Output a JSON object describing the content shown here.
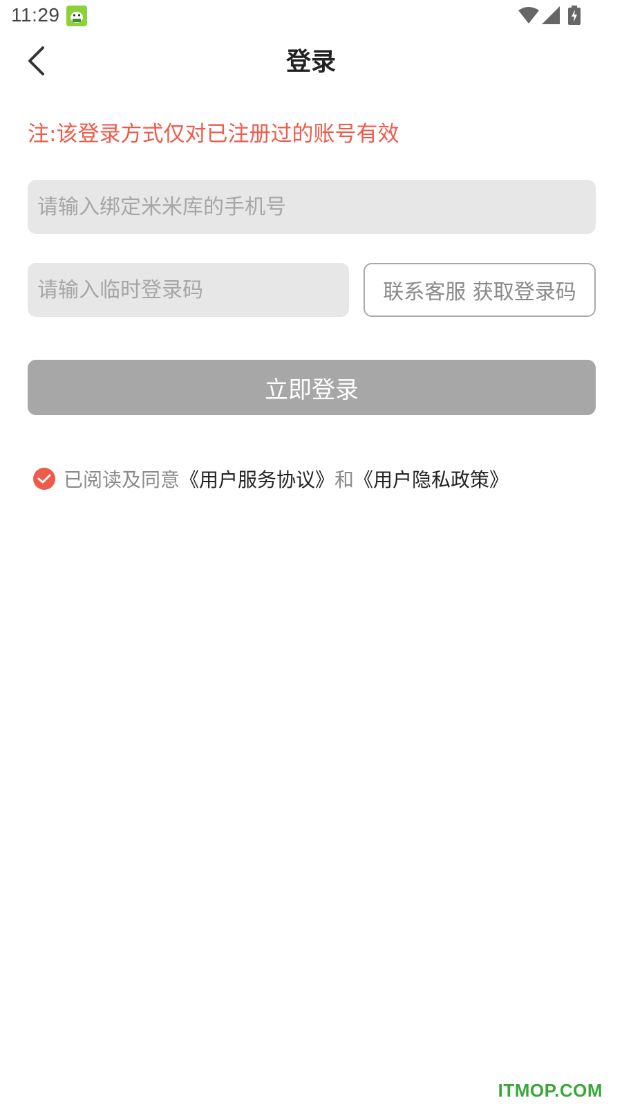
{
  "status_bar": {
    "time": "11:29",
    "icons": [
      "app-badge-icon",
      "wifi-icon",
      "signal-icon",
      "battery-charging-icon"
    ]
  },
  "header": {
    "title": "登录",
    "back_icon": "chevron-left-icon"
  },
  "notice": "注:该登录方式仅对已注册过的账号有效",
  "form": {
    "phone_placeholder": "请输入绑定米米库的手机号",
    "code_placeholder": "请输入临时登录码",
    "get_code_label": "联系客服 获取登录码",
    "submit_label": "立即登录"
  },
  "agreement": {
    "checked": true,
    "prefix": "已阅读及同意",
    "service_link": "《用户服务协议》",
    "and": "和",
    "privacy_link": "《用户隐私政策》"
  },
  "watermark": "ITMOP.COM",
  "colors": {
    "accent": "#ef5b4b",
    "input_bg": "#e7e7e7",
    "button_disabled": "#a7a7a7"
  }
}
